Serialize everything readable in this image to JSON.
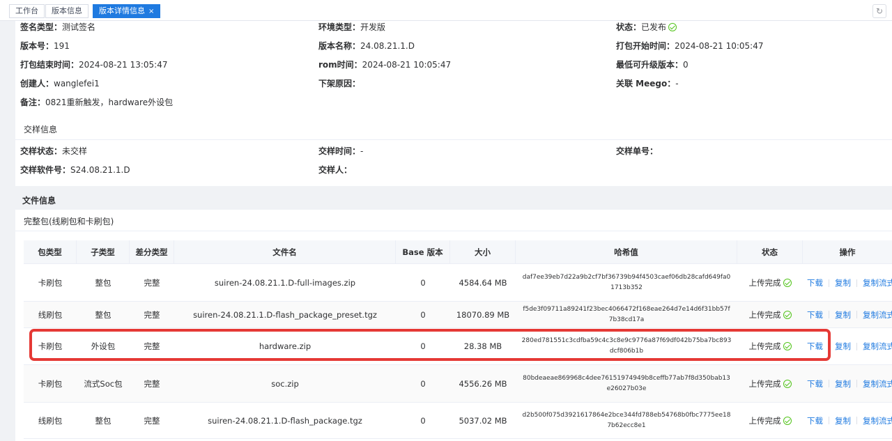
{
  "tabs": [
    {
      "label": "工作台"
    },
    {
      "label": "版本信息"
    },
    {
      "label": "版本详情信息",
      "close": "×"
    }
  ],
  "basic": {
    "sign_type": {
      "label": "签名类型：",
      "value": "测试签名"
    },
    "env_type": {
      "label": "环境类型：",
      "value": "开发版"
    },
    "status": {
      "label": "状态：",
      "value": "已发布"
    },
    "version_no": {
      "label": "版本号：",
      "value": "191"
    },
    "version_name": {
      "label": "版本名称：",
      "value": "24.08.21.1.D"
    },
    "pack_start": {
      "label": "打包开始时间：",
      "value": "2024-08-21 10:05:47"
    },
    "pack_end": {
      "label": "打包结束时间：",
      "value": "2024-08-21 13:05:47"
    },
    "rom_time": {
      "label": "rom时间：",
      "value": "2024-08-21 10:05:47"
    },
    "min_upgrade": {
      "label": "最低可升级版本：",
      "value": "0"
    },
    "creator": {
      "label": "创建人：",
      "value": "wanglefei1"
    },
    "offline_reason": {
      "label": "下架原因：",
      "value": ""
    },
    "meego": {
      "label": "关联 Meego：",
      "value": "-"
    },
    "remark": {
      "label": "备注：",
      "value": "0821重新触发，hardware外设包"
    }
  },
  "sample": {
    "title": "交样信息",
    "status": {
      "label": "交样状态：",
      "value": "未交样"
    },
    "time": {
      "label": "交样时间：",
      "value": "-"
    },
    "order": {
      "label": "交样单号：",
      "value": ""
    },
    "software": {
      "label": "交样软件号：",
      "value": "S24.08.21.1.D"
    },
    "person": {
      "label": "交样人：",
      "value": ""
    }
  },
  "files": {
    "title": "文件信息",
    "subtitle": "完整包(线刷包和卡刷包)",
    "columns": [
      "包类型",
      "子类型",
      "差分类型",
      "文件名",
      "Base 版本",
      "大小",
      "哈希值",
      "状态",
      "操作"
    ],
    "rows": [
      {
        "pkg": "卡刷包",
        "sub": "整包",
        "diff": "完整",
        "file": "suiren-24.08.21.1.D-full-images.zip",
        "base": "0",
        "size": "4584.64 MB",
        "hash": "daf7ee39eb7d22a9b2cf7bf36739b94f4503caef06db28cafd649fa01713b352",
        "status": "上传完成"
      },
      {
        "pkg": "线刷包",
        "sub": "整包",
        "diff": "完整",
        "file": "suiren-24.08.21.1.D-flash_package_preset.tgz",
        "base": "0",
        "size": "18070.89 MB",
        "hash": "f5de3f09711a89241f23bec4066472f168eae264d7e14d6f31bb57f7b38cd17a",
        "status": "上传完成"
      },
      {
        "pkg": "卡刷包",
        "sub": "外设包",
        "diff": "完整",
        "file": "hardware.zip",
        "base": "0",
        "size": "28.38 MB",
        "hash": "280ed781551c3cdfba59c4c3c8e9c9776a87f69df042b75ba7bc893dcf806b1b",
        "status": "上传完成"
      },
      {
        "pkg": "卡刷包",
        "sub": "流式Soc包",
        "diff": "完整",
        "file": "soc.zip",
        "base": "0",
        "size": "4556.26 MB",
        "hash": "80bdeaeae869968c4dee76151974949b8ceffb77ab7f8d350bab13e26027b03e",
        "status": "上传完成"
      },
      {
        "pkg": "线刷包",
        "sub": "整包",
        "diff": "完整",
        "file": "suiren-24.08.21.1.D-flash_package.tgz",
        "base": "0",
        "size": "5037.02 MB",
        "hash": "d2b500f075d3921617864e2bce344fd788eb54768b0fbc7775ee187b62ecc8e1",
        "status": "上传完成"
      }
    ],
    "ops": {
      "download": "下载",
      "copy": "复制",
      "copy_stream": "复制流式"
    }
  }
}
